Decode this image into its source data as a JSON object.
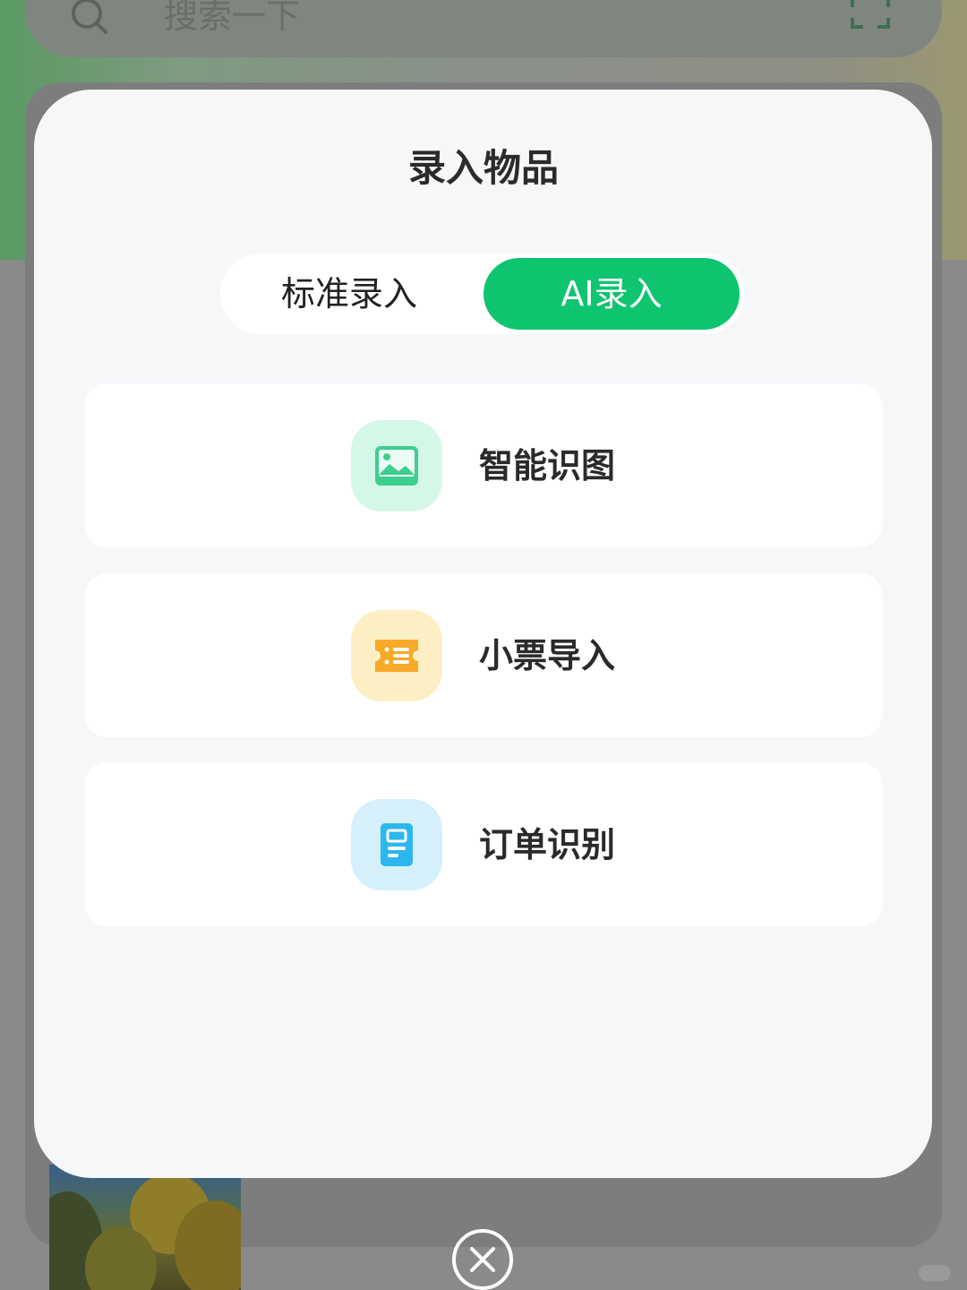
{
  "background": {
    "search_placeholder": "搜索一下"
  },
  "modal": {
    "title": "录入物品",
    "tabs": [
      {
        "label": "标准录入",
        "selected": false
      },
      {
        "label": "AI录入",
        "selected": true
      }
    ],
    "options": [
      {
        "label": "智能识图",
        "icon": "image-icon",
        "icon_bg": "#d5f7e8",
        "icon_color": "#3ccf8e"
      },
      {
        "label": "小票导入",
        "icon": "receipt-icon",
        "icon_bg": "#fdefc4",
        "icon_color": "#f7a928"
      },
      {
        "label": "订单识别",
        "icon": "document-icon",
        "icon_bg": "#d6f0fb",
        "icon_color": "#2cb7ee"
      }
    ]
  },
  "colors": {
    "accent": "#0ec46f",
    "modal_bg": "#f5f7f9",
    "overlay": "#8a8a8a"
  }
}
